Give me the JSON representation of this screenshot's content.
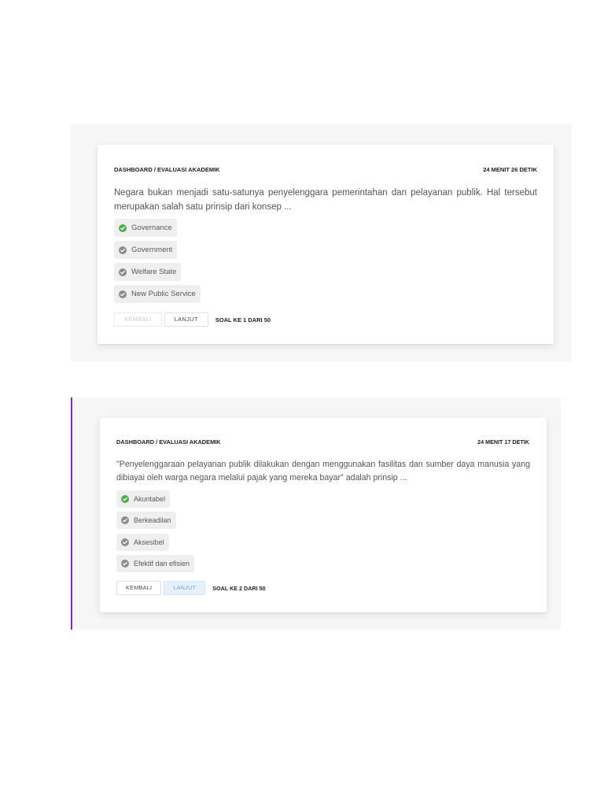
{
  "colors": {
    "selected_icon": "#4caf50",
    "unselected_icon": "#8c8c8c",
    "accent_bar": "#8e24aa",
    "active_button_text": "#6ea8e3"
  },
  "panels": [
    {
      "breadcrumb": "DASHBOARD / EVALUASI AKADEMIK",
      "timer": "24 MENIT 26 DETIK",
      "question": "Negara bukan menjadi satu-satunya penyelenggara pemerintahan dan pelayanan publik. Hal tersebut merupakan salah satu prinsip dari konsep ...",
      "options": [
        {
          "label": "Governance",
          "icon": "check-circle-icon",
          "selected": true
        },
        {
          "label": "Government",
          "icon": "check-circle-icon",
          "selected": false
        },
        {
          "label": "Welfare State",
          "icon": "check-circle-icon",
          "selected": false
        },
        {
          "label": "New Public Service",
          "icon": "check-circle-icon",
          "selected": false
        }
      ],
      "back_button": {
        "label": "KEMBALI",
        "disabled": true,
        "active": false
      },
      "next_button": {
        "label": "LANJUT",
        "disabled": false,
        "active": false
      },
      "counter": "SOAL KE 1 DARI 50"
    },
    {
      "breadcrumb": "DASHBOARD / EVALUASI AKADEMIK",
      "timer": "24 MENIT 17 DETIK",
      "question": "\"Penyelenggaraan pelayanan publik dilakukan dengan menggunakan fasilitas dan sumber daya manusia yang dibiayai oleh warga negara melalui pajak yang mereka bayar\" adalah prinsip ...",
      "options": [
        {
          "label": "Akuntabel",
          "icon": "check-circle-icon",
          "selected": true
        },
        {
          "label": "Berkeadilan",
          "icon": "check-circle-icon",
          "selected": false
        },
        {
          "label": "Aksesibel",
          "icon": "check-circle-icon",
          "selected": false
        },
        {
          "label": "Efektif dan efisien",
          "icon": "check-circle-icon",
          "selected": false
        }
      ],
      "back_button": {
        "label": "KEMBALI",
        "disabled": false,
        "active": false
      },
      "next_button": {
        "label": "LANJUT",
        "disabled": false,
        "active": true
      },
      "counter": "SOAL KE 2 DARI 50"
    }
  ]
}
